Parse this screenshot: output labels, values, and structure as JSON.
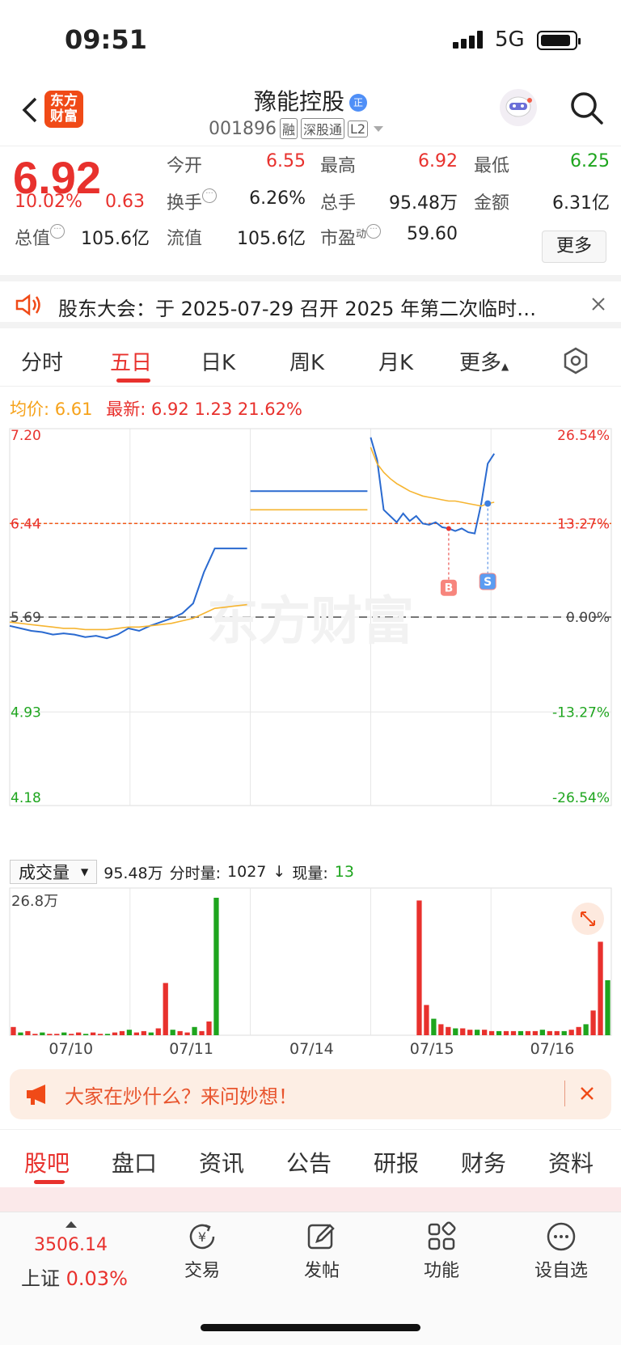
{
  "status": {
    "time": "09:51",
    "network": "5G"
  },
  "header": {
    "logo_line1": "东方",
    "logo_line2": "财富",
    "name": "豫能控股",
    "name_badge": "正",
    "code": "001896",
    "tags": [
      "融",
      "深股通",
      "L2"
    ]
  },
  "quote": {
    "price": "6.92",
    "change_pct": "10.02%",
    "change": "0.63",
    "open_label": "今开",
    "open": "6.55",
    "high_label": "最高",
    "high": "6.92",
    "low_label": "最低",
    "low": "6.25",
    "turnover_label": "换手",
    "turnover": "6.26%",
    "volume_label": "总手",
    "volume": "95.48万",
    "amount_label": "金额",
    "amount": "6.31亿",
    "mktcap_label": "总值",
    "mktcap": "105.6亿",
    "float_label": "流值",
    "float": "105.6亿",
    "pe_label": "市盈",
    "pe_sup": "动",
    "pe": "59.60",
    "more_label": "更多"
  },
  "notice": {
    "text": "股东大会：于 2025-07-29 召开 2025 年第二次临时…"
  },
  "chart_tabs": [
    "分时",
    "五日",
    "日K",
    "周K",
    "月K",
    "更多"
  ],
  "info_line": {
    "avg_label": "均价:",
    "avg": "6.61",
    "last_label": "最新:",
    "last": "6.92",
    "chg": "1.23",
    "chg_pct": "21.62%"
  },
  "chart_data": {
    "type": "line",
    "title": "",
    "x_days": [
      "07/10",
      "07/11",
      "07/14",
      "07/15",
      "07/16"
    ],
    "y_ticks_left": [
      "7.20",
      "6.44",
      "5.69",
      "4.93",
      "4.18"
    ],
    "y_ticks_right": [
      "26.54%",
      "13.27%",
      "0.00%",
      "-13.27%",
      "-26.54%"
    ],
    "ylim": [
      4.18,
      7.2
    ],
    "prev_close": 5.69,
    "limit_line": 6.44,
    "series": [
      {
        "name": "",
        "values": [
          5.62,
          5.6,
          5.58,
          5.57,
          5.55,
          5.56,
          5.55,
          5.53,
          5.54,
          5.52,
          5.55,
          5.6,
          5.58,
          5.62,
          5.65,
          5.68,
          5.72,
          5.8,
          6.05,
          6.24,
          6.24,
          6.24,
          6.24,
          6.7,
          6.7,
          6.7,
          6.7,
          6.7,
          6.7,
          6.7,
          6.7,
          6.7,
          6.7,
          7.13,
          6.95,
          6.55,
          6.5,
          6.45,
          6.52,
          6.46,
          6.5,
          6.44,
          6.43,
          6.45,
          6.41,
          6.4,
          6.38,
          6.4,
          6.37,
          6.36,
          6.6,
          6.92,
          7.0
        ]
      },
      {
        "name": "",
        "values": [
          5.65,
          5.64,
          5.63,
          5.62,
          5.61,
          5.6,
          5.6,
          5.59,
          5.59,
          5.59,
          5.6,
          5.61,
          5.61,
          5.62,
          5.63,
          5.64,
          5.66,
          5.68,
          5.72,
          5.76,
          5.77,
          5.78,
          5.79,
          6.55,
          6.55,
          6.55,
          6.55,
          6.55,
          6.55,
          6.55,
          6.55,
          6.55,
          6.55,
          7.05,
          6.92,
          6.85,
          6.8,
          6.76,
          6.73,
          6.7,
          6.68,
          6.66,
          6.65,
          6.64,
          6.63,
          6.62,
          6.62,
          6.61,
          6.6,
          6.59,
          6.58,
          6.6,
          6.61
        ]
      }
    ],
    "volume_max_label": "26.8万",
    "volume": [
      6,
      2,
      3,
      1,
      2,
      1,
      1,
      2,
      1,
      2,
      1,
      2,
      1,
      1,
      2,
      3,
      4,
      2,
      3,
      2,
      5,
      38,
      4,
      3,
      2,
      6,
      3,
      10,
      100,
      0,
      0,
      0,
      0,
      0,
      0,
      0,
      0,
      0,
      0,
      0,
      0,
      0,
      0,
      0,
      0,
      0,
      0,
      0,
      0,
      0,
      0,
      0,
      0,
      0,
      0,
      0,
      98,
      22,
      12,
      8,
      6,
      5,
      5,
      4,
      4,
      4,
      3,
      3,
      3,
      3,
      3,
      3,
      3,
      4,
      3,
      3,
      3,
      4,
      6,
      8,
      18,
      68,
      40
    ],
    "markers": [
      {
        "label": "B"
      },
      {
        "label": "S"
      }
    ]
  },
  "volume_bar": {
    "select_label": "成交量",
    "total": "95.48万",
    "fen_label": "分时量:",
    "fen_value": "1027",
    "now_label": "现量:",
    "now_value": "13"
  },
  "watermark": "东方财富",
  "promo": {
    "text": "大家在炒什么？来问妙想！"
  },
  "bottom_tabs": [
    "股吧",
    "盘口",
    "资讯",
    "公告",
    "研报",
    "财务",
    "资料"
  ],
  "toolbar": {
    "index_value": "3506.14",
    "index_name": "上证",
    "index_pct": "0.03%",
    "items": [
      "交易",
      "发帖",
      "功能",
      "设自选"
    ]
  },
  "colors": {
    "up": "#e8312d",
    "down": "#1ea51e",
    "price_line": "#2a6ad0",
    "avg_line": "#f6b531"
  }
}
